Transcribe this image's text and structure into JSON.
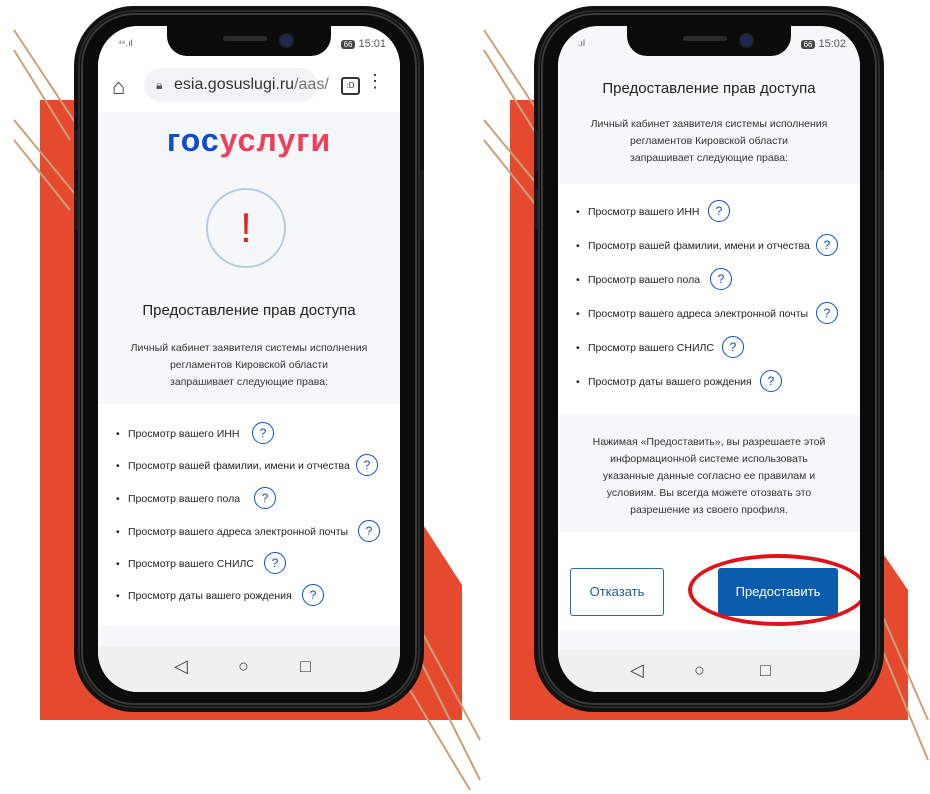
{
  "colors": {
    "accent": "#e54a2f",
    "brand_blue": "#0d4cd3",
    "brand_red": "#ee3f58",
    "button_blue": "#0a5cad",
    "highlight": "#e0131b"
  },
  "left_phone": {
    "status": {
      "signal": "⁴⁶.ıl",
      "battery": "66",
      "time": "15:01"
    },
    "browser": {
      "home_icon": "home-icon",
      "lock_icon": "lock-icon",
      "url_main": "esia.gosuslugi.ru",
      "url_path": "/aas/",
      "tabs_label": ":D",
      "menu_icon": "⋮"
    },
    "logo": {
      "part1": "гос",
      "part2": "услуги"
    },
    "alert_icon": "!",
    "title": "Предоставление прав доступа",
    "desc_lines": [
      "Личный кабинет заявителя системы исполнения",
      "регламентов Кировской области",
      "запрашивает следующие права:"
    ],
    "permissions": [
      {
        "label": "Просмотр вашего ИНН",
        "help": "?"
      },
      {
        "label": "Просмотр вашей фамилии, имени и отчества",
        "help": "?"
      },
      {
        "label": "Просмотр вашего пола",
        "help": "?"
      },
      {
        "label": "Просмотр вашего адреса электронной почты",
        "help": "?"
      },
      {
        "label": "Просмотр вашего СНИЛС",
        "help": "?"
      },
      {
        "label": "Просмотр даты вашего рождения",
        "help": "?"
      }
    ],
    "nav": {
      "back": "◁",
      "home": "○",
      "recent": "□"
    }
  },
  "right_phone": {
    "status": {
      "signal": ".ıl",
      "battery": "66",
      "time": "15:02"
    },
    "title": "Предоставление прав доступа",
    "desc_lines": [
      "Личный кабинет заявителя системы исполнения",
      "регламентов Кировской области",
      "запрашивает следующие права:"
    ],
    "permissions": [
      {
        "label": "Просмотр вашего ИНН",
        "help": "?"
      },
      {
        "label": "Просмотр вашей фамилии, имени и отчества",
        "help": "?"
      },
      {
        "label": "Просмотр вашего пола",
        "help": "?"
      },
      {
        "label": "Просмотр вашего адреса электронной почты",
        "help": "?"
      },
      {
        "label": "Просмотр вашего СНИЛС",
        "help": "?"
      },
      {
        "label": "Просмотр даты вашего рождения",
        "help": "?"
      }
    ],
    "notice_lines": [
      "Нажимая «Предоставить», вы разрешаете этой",
      "информационной системе использовать",
      "указанные данные согласно ее правилам и",
      "условиям. Вы всегда можете отозвать это",
      "разрешение из своего профиля."
    ],
    "buttons": {
      "decline": "Отказать",
      "grant": "Предоставить"
    },
    "nav": {
      "back": "◁",
      "home": "○",
      "recent": "□"
    }
  }
}
